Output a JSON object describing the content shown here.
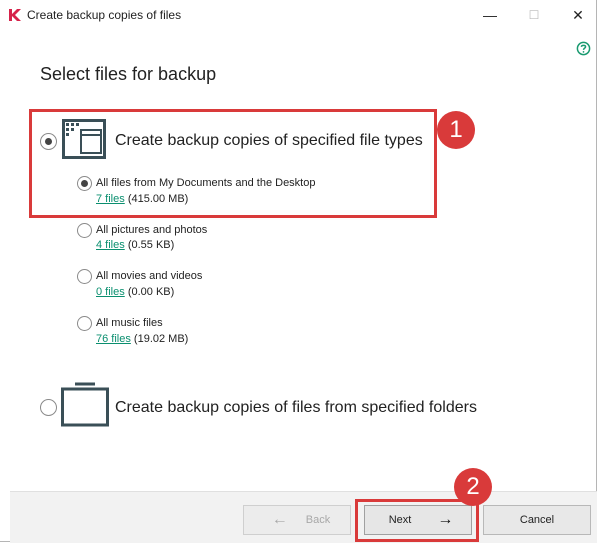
{
  "window": {
    "title": "Create backup copies of files",
    "minimize": "—",
    "maximize": "☐",
    "close": "✕"
  },
  "page": {
    "heading": "Select files for backup"
  },
  "options": {
    "file_types": {
      "label": "Create backup copies of specified file types",
      "selected": true
    },
    "folders": {
      "label": "Create backup copies of files from specified folders",
      "selected": false
    }
  },
  "sub_options": [
    {
      "label": "All files from My Documents and the Desktop",
      "files_link": "7 files",
      "size": "(415.00 MB)",
      "selected": true
    },
    {
      "label": "All pictures and photos",
      "files_link": "4 files",
      "size": "(0.55 KB)",
      "selected": false
    },
    {
      "label": "All movies and videos",
      "files_link": "0 files",
      "size": "(0.00 KB)",
      "selected": false
    },
    {
      "label": "All music files",
      "files_link": "76 files",
      "size": "(19.02 MB)",
      "selected": false
    }
  ],
  "annotations": {
    "step1": "1",
    "step2": "2",
    "color": "#d93a3a"
  },
  "footer": {
    "back_label": "Back",
    "back_arrow": "←",
    "next_label": "Next",
    "next_arrow": "→",
    "cancel_label": "Cancel"
  },
  "colors": {
    "link": "#0a8f6f",
    "help": "#1a9a70",
    "logo": "#d6224a"
  },
  "icons": {
    "help": "help-circle-icon",
    "file_types": "window-grid-icon",
    "folders": "folder-icon",
    "logo": "kaspersky-k-icon"
  }
}
